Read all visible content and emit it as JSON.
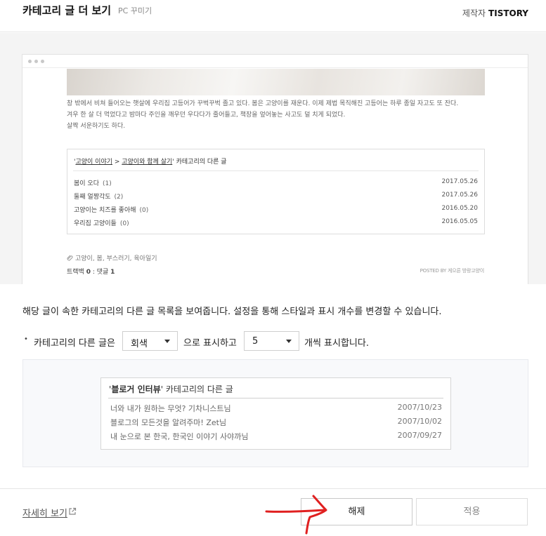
{
  "header": {
    "title": "카테고리 글 더 보기",
    "subtitle": "PC 꾸미기",
    "maker_label": "제작자",
    "maker_name": "TISTORY"
  },
  "preview": {
    "post_text": [
      "창 밖에서 비쳐 들어오는 햇살에 우리집 고등어가 꾸벅꾸벅 졸고 있다. 봄은 고양이를 재운다. 이제 제법 목직해진 고등어는 하루 종일 자고도 또 잔다.",
      "겨우 한 살 더 먹었다고 밤마다 주인을 깨우던 우다다가 줄어들고, 책장을 엎어놓는 사고도 덜 치게 되었다.",
      "살짝 서운하기도 하다."
    ],
    "category": {
      "path_a": "고양이 이야기",
      "sep": " > ",
      "path_b": "고양이와 함께 살기",
      "quote_open": "'",
      "quote_close": "'",
      "suffix": " 카테고리의 다른 글",
      "items": [
        {
          "title": "봄이 오다",
          "count": "(1)",
          "date": "2017.05.26"
        },
        {
          "title": "둘째 얼짱각도",
          "count": "(2)",
          "date": "2017.05.26"
        },
        {
          "title": "고양이는 치즈를 좋아해",
          "count": "(0)",
          "date": "2016.05.20"
        },
        {
          "title": "우리집 고양이들",
          "count": "(0)",
          "date": "2016.05.05"
        }
      ]
    },
    "tags": "고양이, 봄, 부스러기, 육아일기",
    "trackback_label": "트랙백",
    "trackback_count": "0",
    "comment_sep": " : 댓글 ",
    "comment_count": "1",
    "posted_by": "POSTED BY 게으른 방랑고양이"
  },
  "settings": {
    "description": "해당 글이 속한 카테고리의 다른 글 목록을 보여줍니다. 설정을 통해 스타일과 표시 개수를 변경할 수 있습니다.",
    "bullet": "•",
    "label_1": "카테고리의 다른 글은",
    "style_value": "회색",
    "label_2": "으로 표시하고",
    "count_value": "5",
    "label_3": "개씩 표시합니다."
  },
  "sample": {
    "quote_open": "'",
    "blog_name": "블로거 인터뷰",
    "quote_close": "'",
    "suffix": " 카테고리의 다른 글",
    "items": [
      {
        "title": "너와 내가 원하는 무엇? 기차니스트님",
        "date": "2007/10/23"
      },
      {
        "title": "블로그의 모든것을 알려주마! Zet님",
        "date": "2007/10/02"
      },
      {
        "title": "내 눈으로 본 한국, 한국인 이야기 사야까님",
        "date": "2007/09/27"
      }
    ]
  },
  "footer": {
    "more_link": "자세히 보기",
    "release_button": "해제",
    "apply_button": "적용"
  },
  "colors": {
    "annotation_arrow": "#e02020",
    "preview_bg": "#f4f4f4",
    "sample_bg": "#f8f9fb"
  }
}
